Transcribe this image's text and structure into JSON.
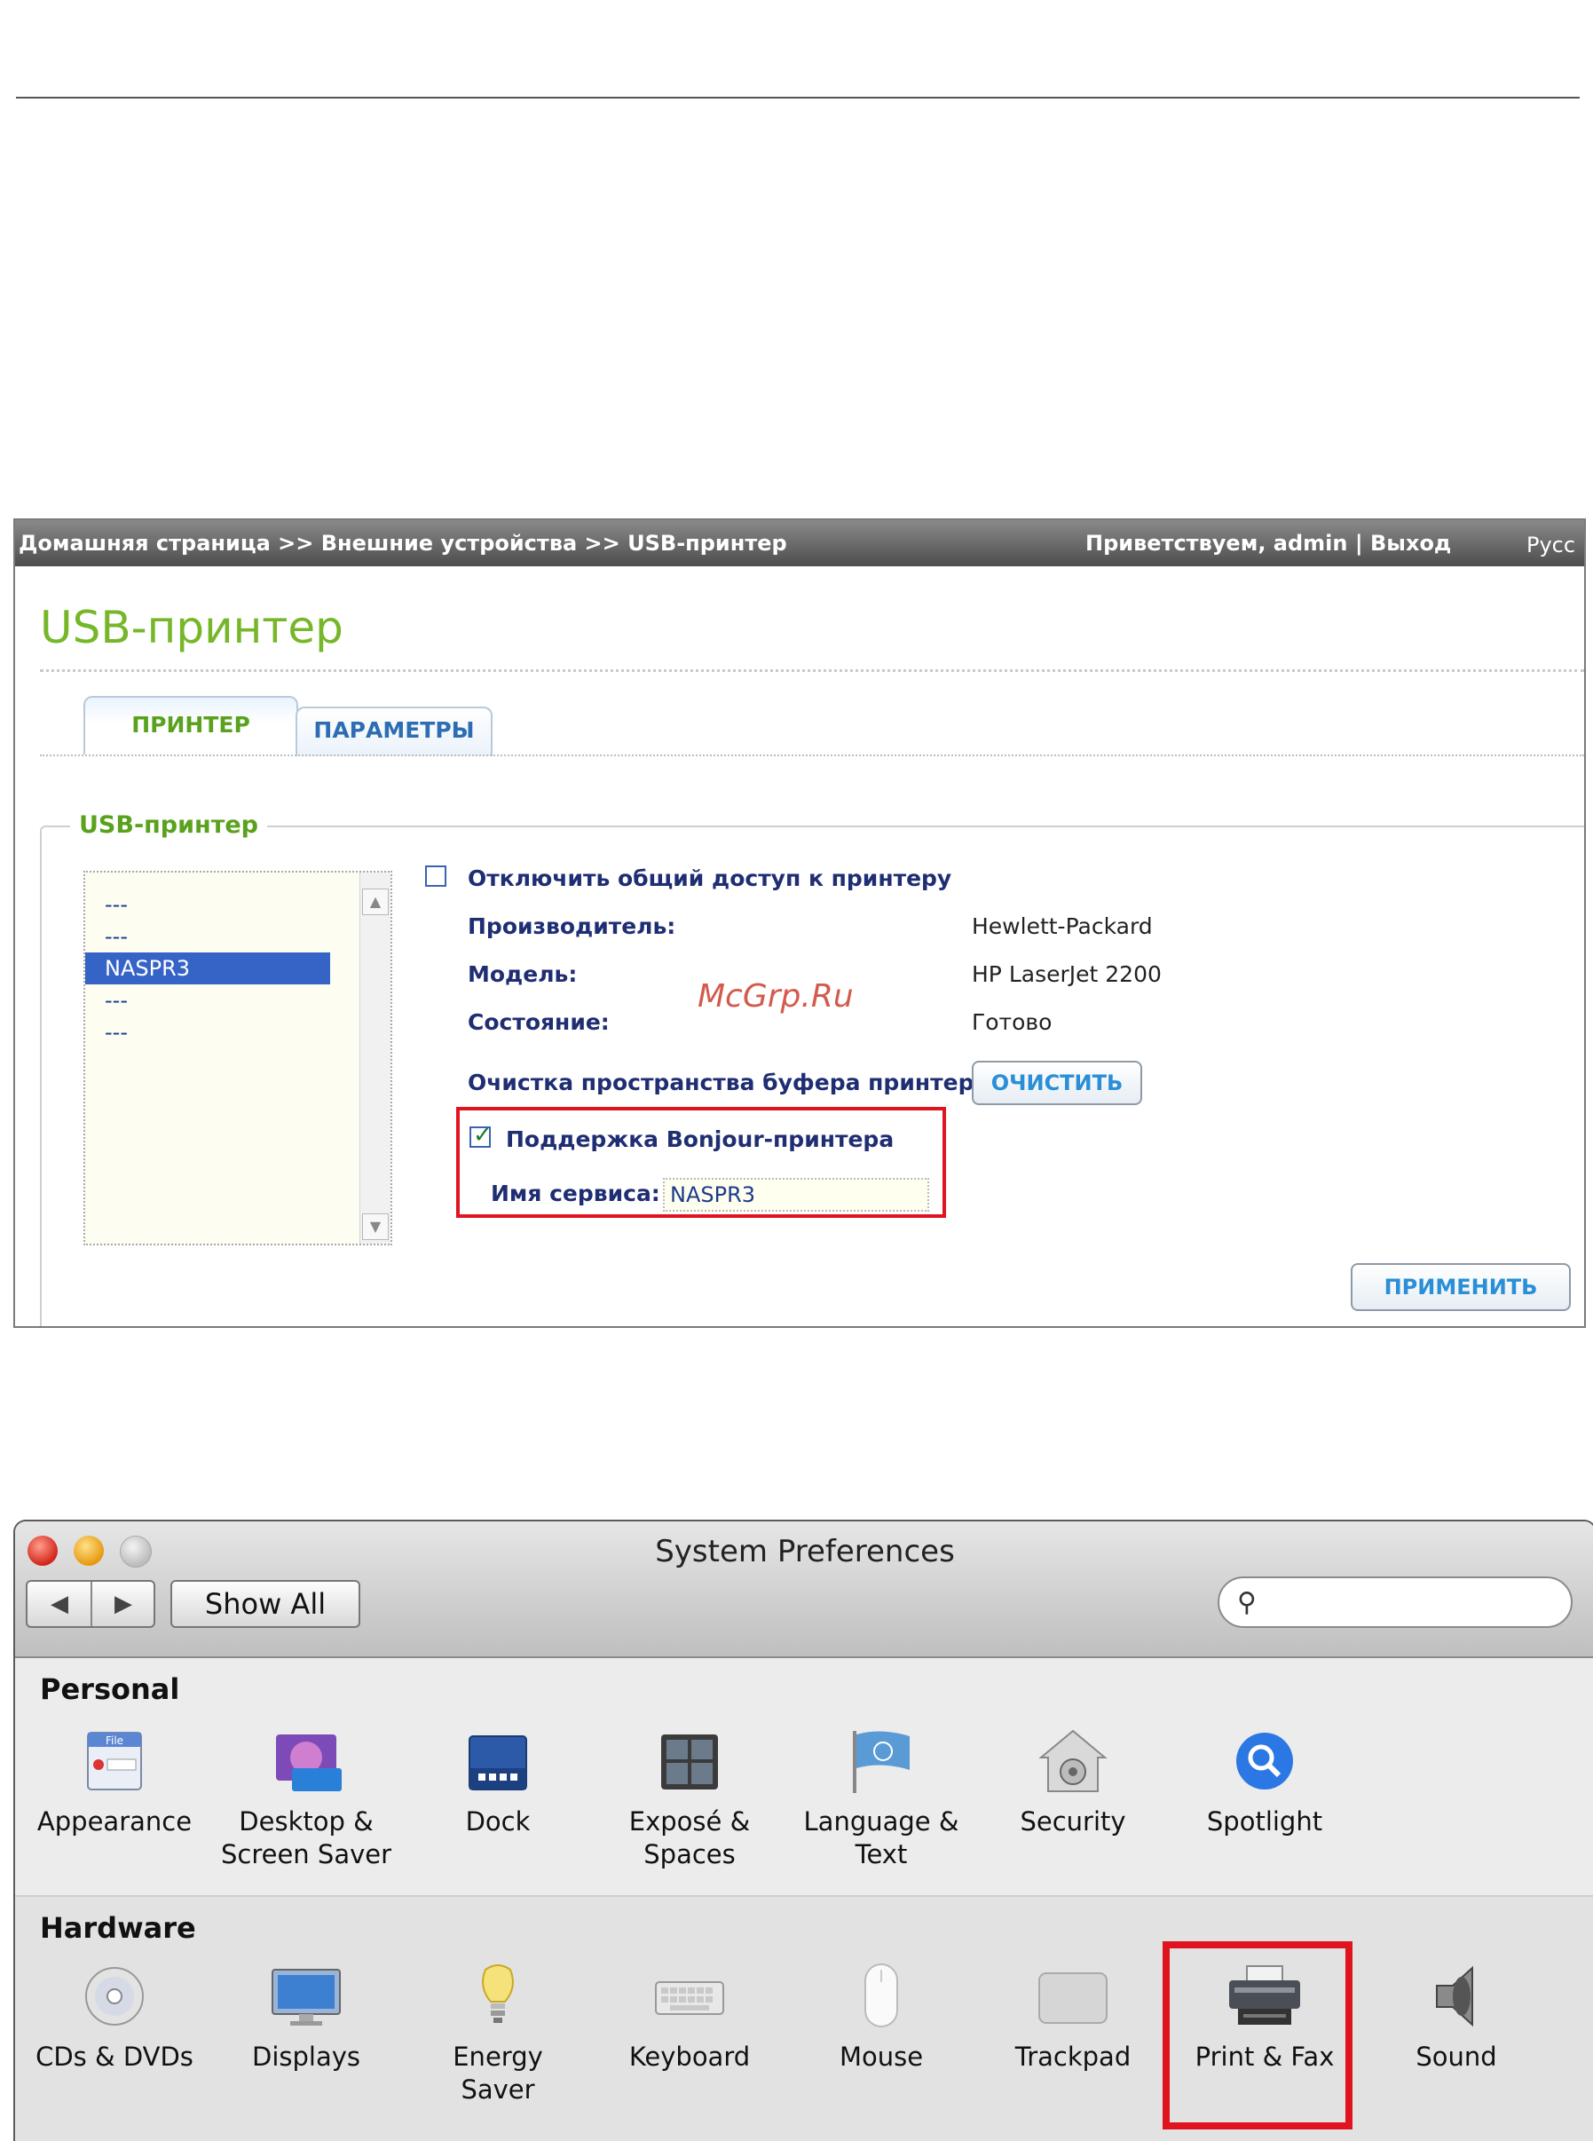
{
  "nas": {
    "breadcrumb": "Домашняя страница >> Внешние устройства >> USB-принтер",
    "greeting": "Приветствуем,  admin | Выход",
    "language": "Русс",
    "title": "USB-принтер",
    "tabs": [
      {
        "label": "ПРИНТЕР",
        "active": true
      },
      {
        "label": "ПАРАМЕТРЫ",
        "active": false
      }
    ],
    "legend": "USB-принтер",
    "printer_list": [
      "---",
      "---",
      "NASPR3",
      "---",
      "---"
    ],
    "selected_index": 2,
    "disable_sharing_label": "Отключить общий доступ к принтеру",
    "disable_sharing_checked": false,
    "manufacturer_label": "Производитель:",
    "manufacturer_value": "Hewlett-Packard",
    "model_label": "Модель:",
    "model_value": "HP LaserJet 2200",
    "status_label": "Состояние:",
    "status_value": "Готово",
    "spool_label": "Очистка пространства буфера принтера",
    "clear_button": "ОЧИСТИТЬ",
    "bonjour_label": "Поддержка Bonjour-принтера",
    "bonjour_checked": true,
    "service_name_label": "Имя сервиса:",
    "service_name_value": "NASPR3",
    "apply_button": "ПРИМЕНИТЬ",
    "watermark": "McGrp.Ru",
    "accent_color": "#76b72a",
    "highlight_color": "#e0141e"
  },
  "sysprefs": {
    "window_title": "System Preferences",
    "back_icon": "back-arrow-icon",
    "forward_icon": "forward-arrow-icon",
    "show_all": "Show All",
    "search_placeholder": "",
    "sections": [
      {
        "title": "Personal",
        "items": [
          {
            "name": "Appearance",
            "icon": "appearance-icon"
          },
          {
            "name": "Desktop &\nScreen Saver",
            "icon": "desktop-icon"
          },
          {
            "name": "Dock",
            "icon": "dock-icon"
          },
          {
            "name": "Exposé &\nSpaces",
            "icon": "expose-icon"
          },
          {
            "name": "Language &\nText",
            "icon": "language-flag-icon"
          },
          {
            "name": "Security",
            "icon": "security-house-icon"
          },
          {
            "name": "Spotlight",
            "icon": "spotlight-icon"
          }
        ]
      },
      {
        "title": "Hardware",
        "items": [
          {
            "name": "CDs & DVDs",
            "icon": "cd-icon"
          },
          {
            "name": "Displays",
            "icon": "display-icon"
          },
          {
            "name": "Energy\nSaver",
            "icon": "lightbulb-icon"
          },
          {
            "name": "Keyboard",
            "icon": "keyboard-icon"
          },
          {
            "name": "Mouse",
            "icon": "mouse-icon"
          },
          {
            "name": "Trackpad",
            "icon": "trackpad-icon"
          },
          {
            "name": "Print & Fax",
            "icon": "printer-icon"
          },
          {
            "name": "Sound",
            "icon": "speaker-icon"
          }
        ]
      }
    ],
    "highlighted_item": "Print & Fax"
  }
}
